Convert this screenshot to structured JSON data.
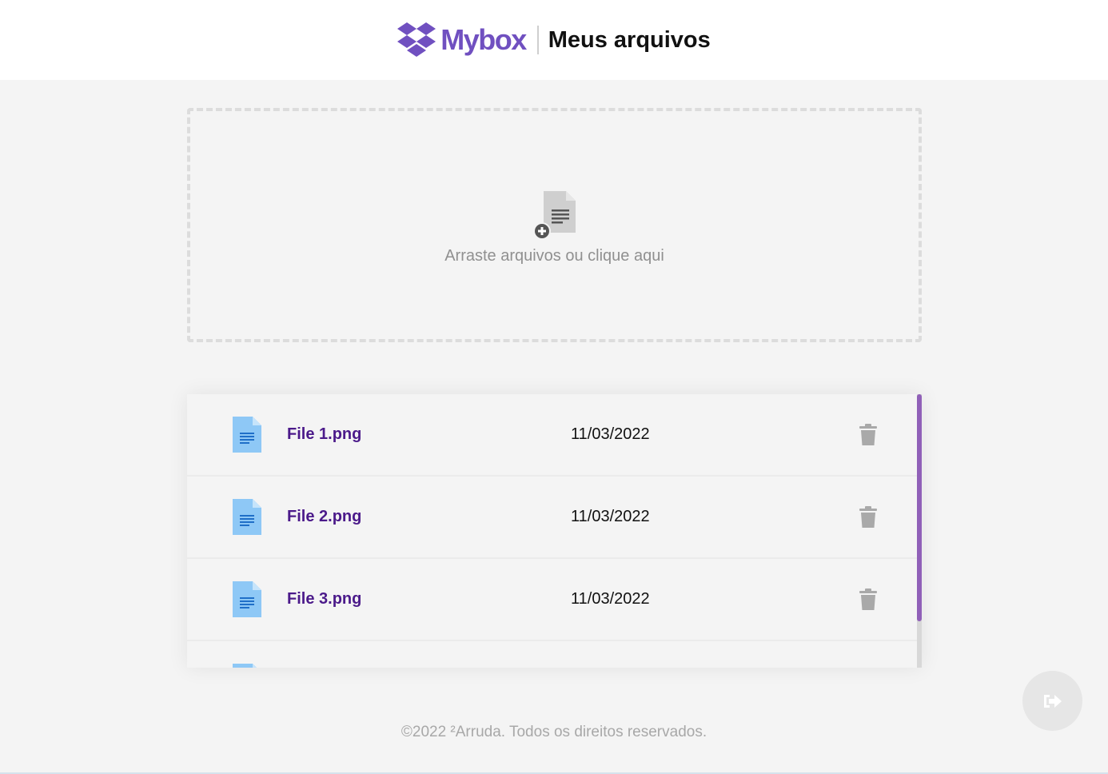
{
  "header": {
    "logo_text": "Mybox",
    "title": "Meus arquivos",
    "brand_color": "#7050c0"
  },
  "dropzone": {
    "text": "Arraste arquivos ou clique aqui",
    "icon": "file-add-icon"
  },
  "files": [
    {
      "name": "File 1.png",
      "date": "11/03/2022",
      "icon": "document-icon"
    },
    {
      "name": "File 2.png",
      "date": "11/03/2022",
      "icon": "document-icon"
    },
    {
      "name": "File 3.png",
      "date": "11/03/2022",
      "icon": "document-icon"
    },
    {
      "name": "",
      "date": "",
      "icon": "document-icon"
    }
  ],
  "logout": {
    "icon": "sign-out-icon"
  },
  "footer": {
    "text": "©2022 ²Arruda. Todos os direitos reservados."
  },
  "colors": {
    "file_name": "#4b1a8a",
    "scroll_thumb": "#9060b8",
    "file_icon": "#8ec8f6"
  }
}
